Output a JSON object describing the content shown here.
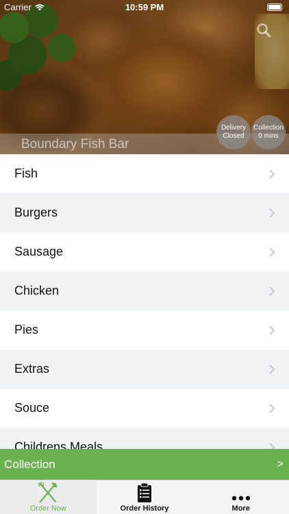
{
  "status_bar": {
    "carrier": "Carrier",
    "time": "10:59 PM"
  },
  "hero": {
    "restaurant_name": "Boundary Fish Bar",
    "delivery_badge": {
      "line1": "Delivery",
      "line2": "Closed"
    },
    "collection_badge": {
      "line1": "Collection",
      "line2": "0 mins"
    }
  },
  "categories": [
    {
      "label": "Fish"
    },
    {
      "label": "Burgers"
    },
    {
      "label": "Sausage"
    },
    {
      "label": "Chicken"
    },
    {
      "label": "Pies"
    },
    {
      "label": "Extras"
    },
    {
      "label": "Souce"
    },
    {
      "label": "Childrens Meals"
    }
  ],
  "collection_bar": {
    "label": "Collection",
    "arrow": ">"
  },
  "tabs": [
    {
      "label": "Order Now",
      "icon": "fork-knife-icon",
      "active": true
    },
    {
      "label": "Order History",
      "icon": "clipboard-icon",
      "active": false
    },
    {
      "label": "More",
      "icon": "more-dots-icon",
      "active": false
    }
  ],
  "colors": {
    "accent": "#6ab24f",
    "tab_bar": "#f4f4f4",
    "row_alt": "#f1f2f4"
  }
}
